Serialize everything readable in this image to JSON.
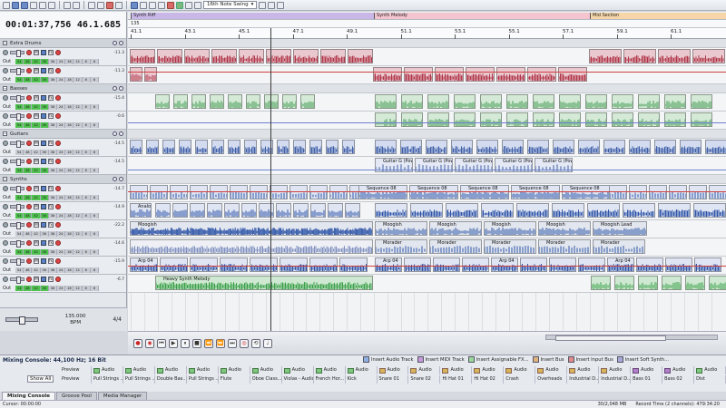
{
  "toolbar": {
    "swing_label": "16th Note Swing"
  },
  "time_display": {
    "clock": "00:01:37,756",
    "measure": "46.1.685"
  },
  "groups": [
    {
      "name": "Extra Drums"
    },
    {
      "name": "Basses"
    },
    {
      "name": "Guitars"
    },
    {
      "name": "Synths"
    }
  ],
  "track_volumes": [
    "-11.3",
    "-11.3",
    "-15.4",
    "-0.6",
    "-14.5",
    "-14.5",
    "-14.7",
    "-14.9",
    "-22.2",
    "-14.6",
    "-15.9",
    "-6.7"
  ],
  "meter_scale": [
    "54",
    "48",
    "42",
    "36",
    "30",
    "24",
    "18",
    "12",
    "6",
    "0"
  ],
  "out_label": "Out",
  "transport": {
    "bpm_value": "135.000",
    "bpm_label": "BPM",
    "time_sig": "4/4"
  },
  "tempo_value": "135",
  "markers": [
    {
      "label": "Synth Riff"
    },
    {
      "label": "Synth Melody"
    },
    {
      "label": "Mid Section"
    }
  ],
  "ruler": [
    "41.1",
    "43.1",
    "45.1",
    "47.1",
    "49.1",
    "51.1",
    "53.1",
    "55.1",
    "57.1",
    "59.1",
    "61.1"
  ],
  "clip_names": {
    "guitar": "Guitar G (Power Chor",
    "sequence": "Sequence 08",
    "analog": "Analog",
    "moogish": "Moogish",
    "moogish_lead": "Moogish Lead",
    "morader": "Morader",
    "arp": "Arp 04",
    "heavy": "Heavy Synth Melody",
    "gain": "-12 (F)"
  },
  "console": {
    "title": "Mixing Console: 44,100 Hz; 16 Bit",
    "buttons": [
      "Insert Audio Track",
      "Insert MIDI Track",
      "Insert Assignable FX...",
      "Insert Bus",
      "Insert Input Bus",
      "Insert Soft Synth..."
    ],
    "show_all": "Show All",
    "preview_row": [
      "Preview",
      "Audio",
      "Audio",
      "Audio",
      "Audio",
      "Audio",
      "Audio",
      "Audio",
      "Audio",
      "Audio",
      "Audio",
      "Audio",
      "Audio",
      "Audio",
      "Audio",
      "Audio",
      "Audio",
      "Audio",
      "Audio",
      "Audio",
      "Audio"
    ],
    "name_row": [
      "Preview",
      "Pull Strings ...",
      "Pull Strings ...",
      "Double Bas...",
      "Pull Strings ...",
      "Flute",
      "Oboe Class...",
      "Violas - Audio",
      "French Hor...",
      "Kick",
      "Snare 01",
      "Snare 02",
      "Hi Hat 01",
      "Hi Hat 02",
      "Crash",
      "Overheads",
      "Industrial D...",
      "Industrial D...",
      "Bass 01",
      "Bass 02",
      "Dist"
    ]
  },
  "tabs": [
    "Mixing Console",
    "Groove Pool",
    "Media Manager"
  ],
  "status": {
    "left": "Cursor: 00:00:00",
    "disk": "30/2,048 MB",
    "record_time": "Record Time (2 channels): 479:34:20"
  },
  "colors": {
    "drums": "#b1364a",
    "bass": "#3f9a52",
    "guitar": "#3f5fa8",
    "synth": "#2f55a8",
    "synth_green": "#3aa048"
  }
}
